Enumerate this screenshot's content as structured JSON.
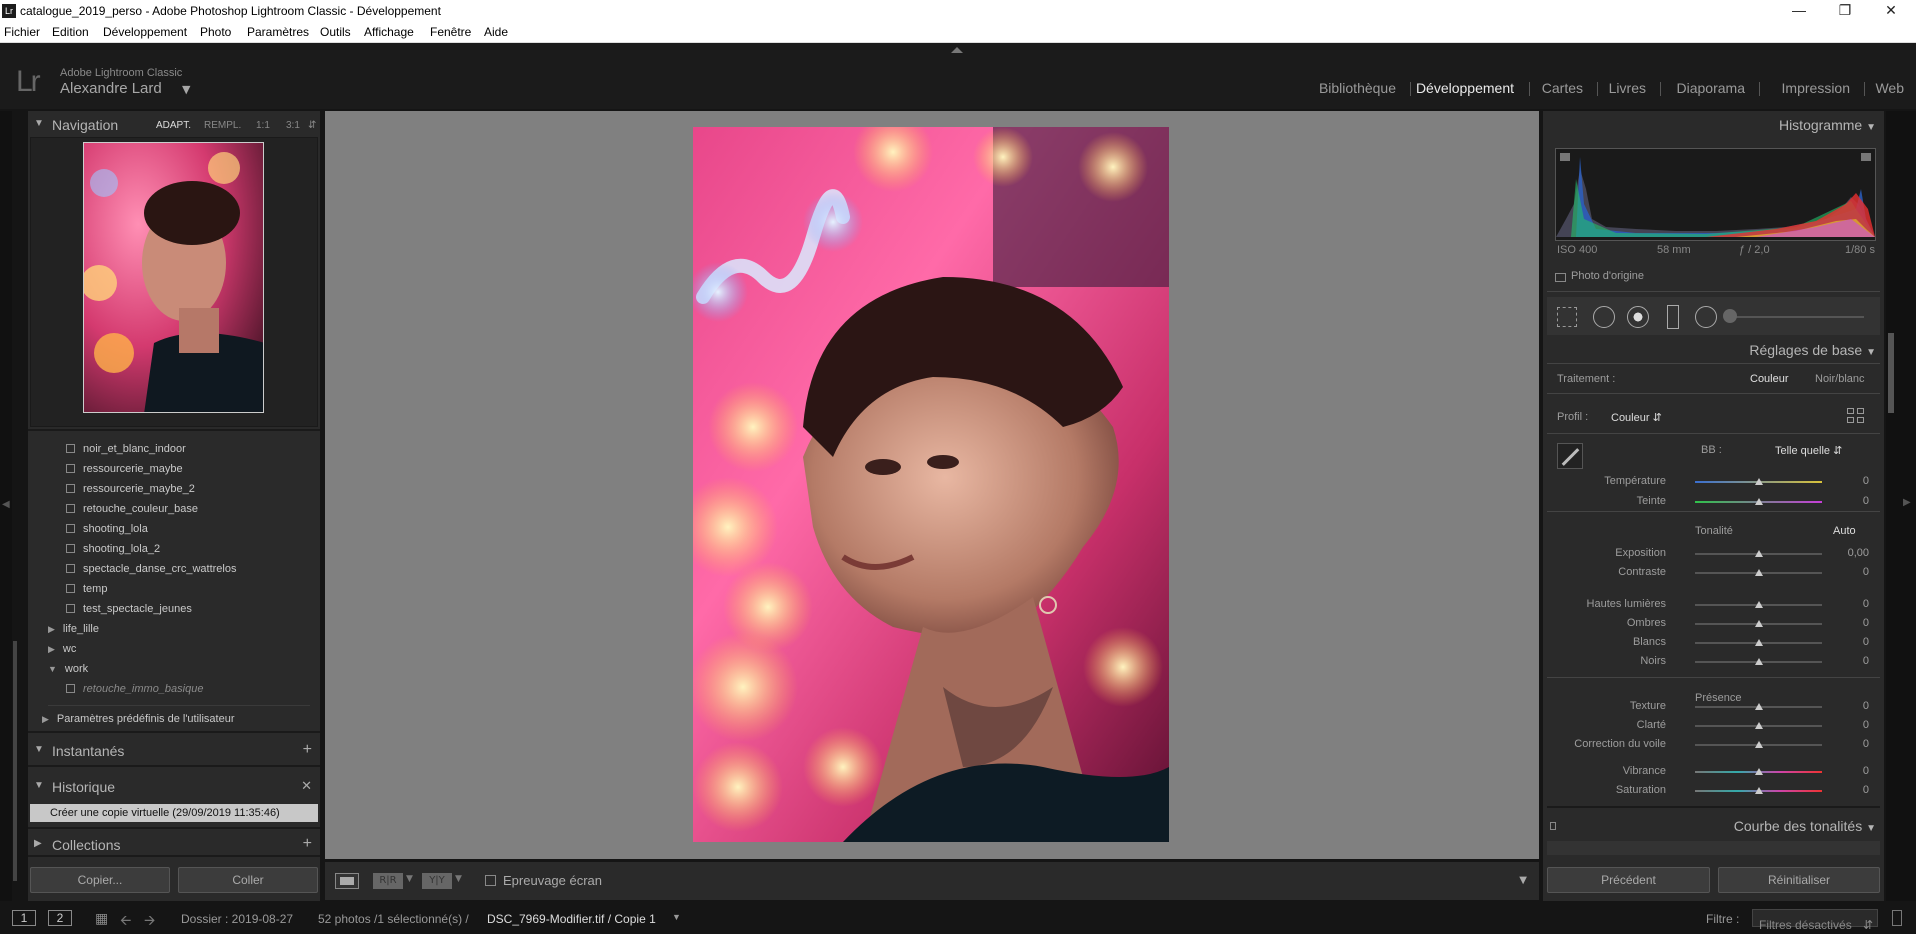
{
  "window": {
    "title": "catalogue_2019_perso - Adobe Photoshop Lightroom Classic - Développement",
    "app_badge": "Lr"
  },
  "menu": [
    "Fichier",
    "Edition",
    "Développement",
    "Photo",
    "Paramètres",
    "Outils",
    "Affichage",
    "Fenêtre",
    "Aide"
  ],
  "identity": {
    "product": "Adobe Lightroom Classic",
    "user": "Alexandre Lard",
    "logo": "Lr"
  },
  "modules": [
    {
      "label": "Bibliothèque",
      "active": false
    },
    {
      "label": "Développement",
      "active": true
    },
    {
      "label": "Cartes",
      "active": false
    },
    {
      "label": "Livres",
      "active": false
    },
    {
      "label": "Diaporama",
      "active": false
    },
    {
      "label": "Impression",
      "active": false
    },
    {
      "label": "Web",
      "active": false
    }
  ],
  "left": {
    "navigation": {
      "title": "Navigation",
      "opts": [
        "ADAPT.",
        "REMPL.",
        "1:1",
        "3:1"
      ]
    },
    "presets": [
      "noir_et_blanc_indoor",
      "ressourcerie_maybe",
      "ressourcerie_maybe_2",
      "retouche_couleur_base",
      "shooting_lola",
      "shooting_lola_2",
      "spectacle_danse_crc_wattrelos",
      "temp",
      "test_spectacle_jeunes"
    ],
    "folders": [
      {
        "label": "life_lille",
        "expanded": false
      },
      {
        "label": "wc",
        "expanded": false
      },
      {
        "label": "work",
        "expanded": true
      }
    ],
    "work_child": "retouche_immo_basique",
    "user_presets": "Paramètres prédéfinis de l'utilisateur",
    "snapshots": "Instantanés",
    "history": "Historique",
    "history_item": "Créer une copie virtuelle (29/09/2019 11:35:46)",
    "collections": "Collections",
    "copy_button": "Copier...",
    "paste_button": "Coller"
  },
  "toolbar": {
    "soft_proof": "Epreuvage écran",
    "compare_ab": "R|R",
    "compare_yy": "Y|Y"
  },
  "right": {
    "histogram": "Histogramme",
    "exif": {
      "iso": "ISO 400",
      "focal": "58 mm",
      "aperture": "ƒ / 2,0",
      "shutter": "1/80 s"
    },
    "original_photo": "Photo d'origine",
    "basic": "Réglages de base",
    "treatment_label": "Traitement :",
    "treatment_color": "Couleur",
    "treatment_bw": "Noir/blanc",
    "profile_label": "Profil :",
    "profile_value": "Couleur",
    "wb_label": "BB :",
    "wb_value": "Telle quelle",
    "tone_label": "Tonalité",
    "auto": "Auto",
    "presence_label": "Présence",
    "tone_curve": "Courbe des tonalités",
    "prev_button": "Précédent",
    "reset_button": "Réinitialiser",
    "sliders": [
      {
        "label": "Température",
        "value": "0",
        "pos": 0.5
      },
      {
        "label": "Teinte",
        "value": "0",
        "pos": 0.5
      },
      {
        "label": "Exposition",
        "value": "0,00",
        "pos": 0.5
      },
      {
        "label": "Contraste",
        "value": "0",
        "pos": 0.5
      },
      {
        "label": "Hautes lumières",
        "value": "0",
        "pos": 0.5
      },
      {
        "label": "Ombres",
        "value": "0",
        "pos": 0.5
      },
      {
        "label": "Blancs",
        "value": "0",
        "pos": 0.5
      },
      {
        "label": "Noirs",
        "value": "0",
        "pos": 0.5
      },
      {
        "label": "Texture",
        "value": "0",
        "pos": 0.5
      },
      {
        "label": "Clarté",
        "value": "0",
        "pos": 0.5
      },
      {
        "label": "Correction du voile",
        "value": "0",
        "pos": 0.5
      },
      {
        "label": "Vibrance",
        "value": "0",
        "pos": 0.5
      },
      {
        "label": "Saturation",
        "value": "0",
        "pos": 0.5
      }
    ]
  },
  "status": {
    "view1": "1",
    "view2": "2",
    "folder": "Dossier : 2019-08-27",
    "count": "52 photos /1 sélectionné(s) /",
    "file": "DSC_7969-Modifier.tif / Copie 1",
    "filter_label": "Filtre :",
    "filter_value": "Filtres désactivés"
  }
}
